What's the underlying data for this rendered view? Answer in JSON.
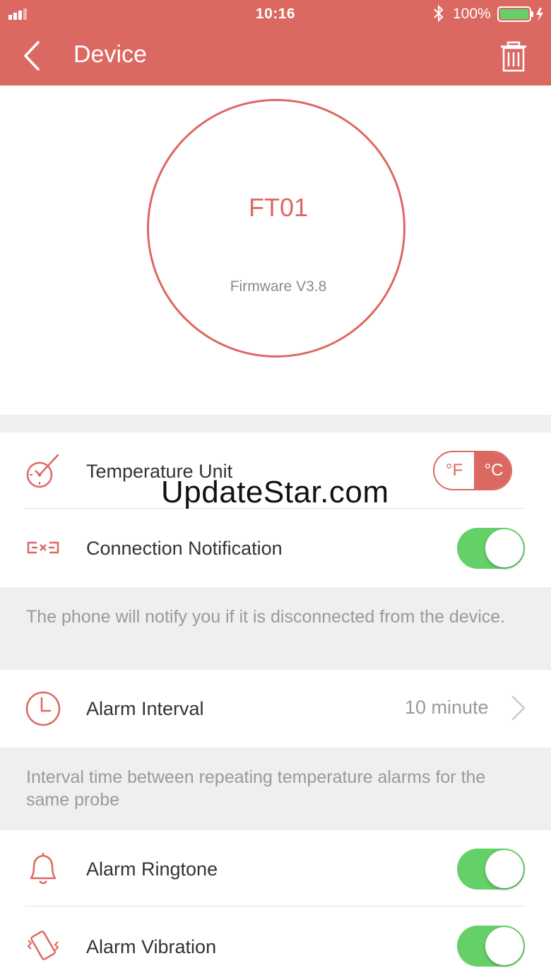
{
  "status_bar": {
    "time": "10:16",
    "battery_percent": "100%"
  },
  "nav": {
    "title": "Device"
  },
  "device": {
    "name": "FT01",
    "firmware": "Firmware V3.8"
  },
  "settings": {
    "temperature_unit": {
      "label": "Temperature Unit",
      "option_f": "°F",
      "option_c": "°C",
      "selected": "°C"
    },
    "connection_notification": {
      "label": "Connection Notification",
      "enabled": true,
      "note": "The phone will notify you if it is disconnected from the device."
    },
    "alarm_interval": {
      "label": "Alarm Interval",
      "value": "10 minute",
      "note": "Interval time between repeating temperature alarms for the same probe"
    },
    "alarm_ringtone": {
      "label": "Alarm Ringtone",
      "enabled": true
    },
    "alarm_vibration": {
      "label": "Alarm Vibration",
      "enabled": true
    }
  },
  "watermark": "UpdateStar.com",
  "colors": {
    "accent": "#dc6862",
    "toggle_on": "#65d067",
    "section_bg": "#efefef"
  }
}
